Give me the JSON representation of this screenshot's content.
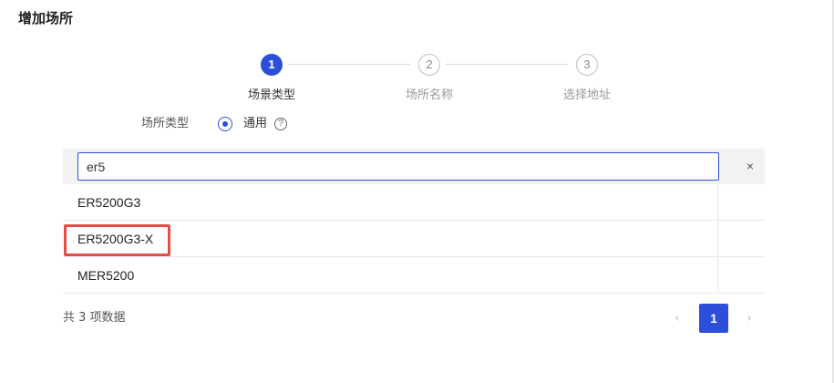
{
  "page": {
    "title": "增加场所"
  },
  "steps": [
    {
      "number": "1",
      "label": "场景类型",
      "state": "active"
    },
    {
      "number": "2",
      "label": "场所名称",
      "state": "idle"
    },
    {
      "number": "3",
      "label": "选择地址",
      "state": "idle"
    }
  ],
  "form": {
    "type_label": "场所类型",
    "radio_option": "通用",
    "help_glyph": "?"
  },
  "dropdown": {
    "search_value": "er5",
    "clear_glyph": "×",
    "items": [
      "ER5200G3",
      "ER5200G3-X",
      "MER5200"
    ],
    "highlighted_item": "ER5200G3-X"
  },
  "pagination": {
    "total_text": "共 3 项数据",
    "prev_glyph": "‹",
    "next_glyph": "›",
    "current_page": "1"
  },
  "colors": {
    "accent": "#2b4fd8",
    "highlight": "#e84a4a"
  }
}
